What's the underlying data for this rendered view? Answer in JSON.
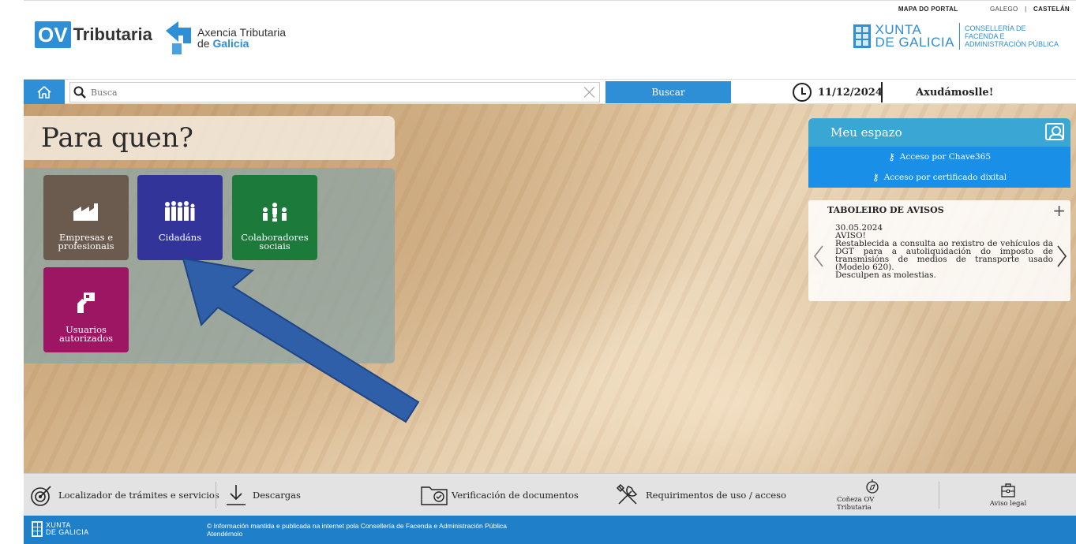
{
  "header": {
    "toplinks": {
      "mapa": "MAPA DO PORTAL",
      "galego": "GALEGO",
      "sep": "|",
      "castelan": "CASTELÁN"
    },
    "brand": {
      "ov": "OV",
      "tributaria": "Tributaria",
      "axencia_line1": "Axencia Tributaria",
      "axencia_de": "de",
      "axencia_galicia": "Galicia"
    },
    "xunta": {
      "line1": "XUNTA",
      "line2": "DE GALICIA",
      "cons1": "CONSELLERÍA DE",
      "cons2": "FACENDA E",
      "cons3": "ADMINISTRACIÓN PÚBLICA"
    }
  },
  "search": {
    "placeholder": "Busca",
    "button": "Buscar"
  },
  "date": "11/12/2024",
  "help": "Axudámoslle!",
  "para_quen": {
    "title": "Para quen?",
    "tiles": [
      {
        "label1": "Empresas e",
        "label2": "profesionais",
        "color": "#6b5a4e"
      },
      {
        "label1": "Cidadáns",
        "label2": "",
        "color": "#32349a"
      },
      {
        "label1": "Colaboradores",
        "label2": "sociais",
        "color": "#1c7a3a"
      },
      {
        "label1": "Usuarios",
        "label2": "autorizados",
        "color": "#9c1663"
      }
    ]
  },
  "meu_espazo": {
    "title": "Meu espazo",
    "links": [
      "Acceso por Chave365",
      "Acceso por certificado dixital"
    ]
  },
  "avisos": {
    "title": "TABOLEIRO DE AVISOS",
    "date": "30.05.2024",
    "headline": "AVISO!",
    "text": "Restablecida a consulta ao rexistro de vehículos da DGT para a autoliquidación do imposto de transmisións de medios de transporte usado (Modelo 620).",
    "closing": "Desculpen as molestias."
  },
  "bottom": {
    "localizador": "Localizador de trámites e servicios",
    "descargas": "Descargas",
    "verificacion": "Verificación de documentos",
    "requirimentos": "Requirimentos de uso / acceso",
    "coneza": "Coñeza OV Tributaria",
    "aviso_legal": "Aviso legal"
  },
  "footer": {
    "xunta1": "XUNTA",
    "xunta2": "DE GALICIA",
    "copyright": "© Información mantida e publicada na internet pola Consellería de Facenda e Administración Pública",
    "contact": "Atendémolo"
  }
}
